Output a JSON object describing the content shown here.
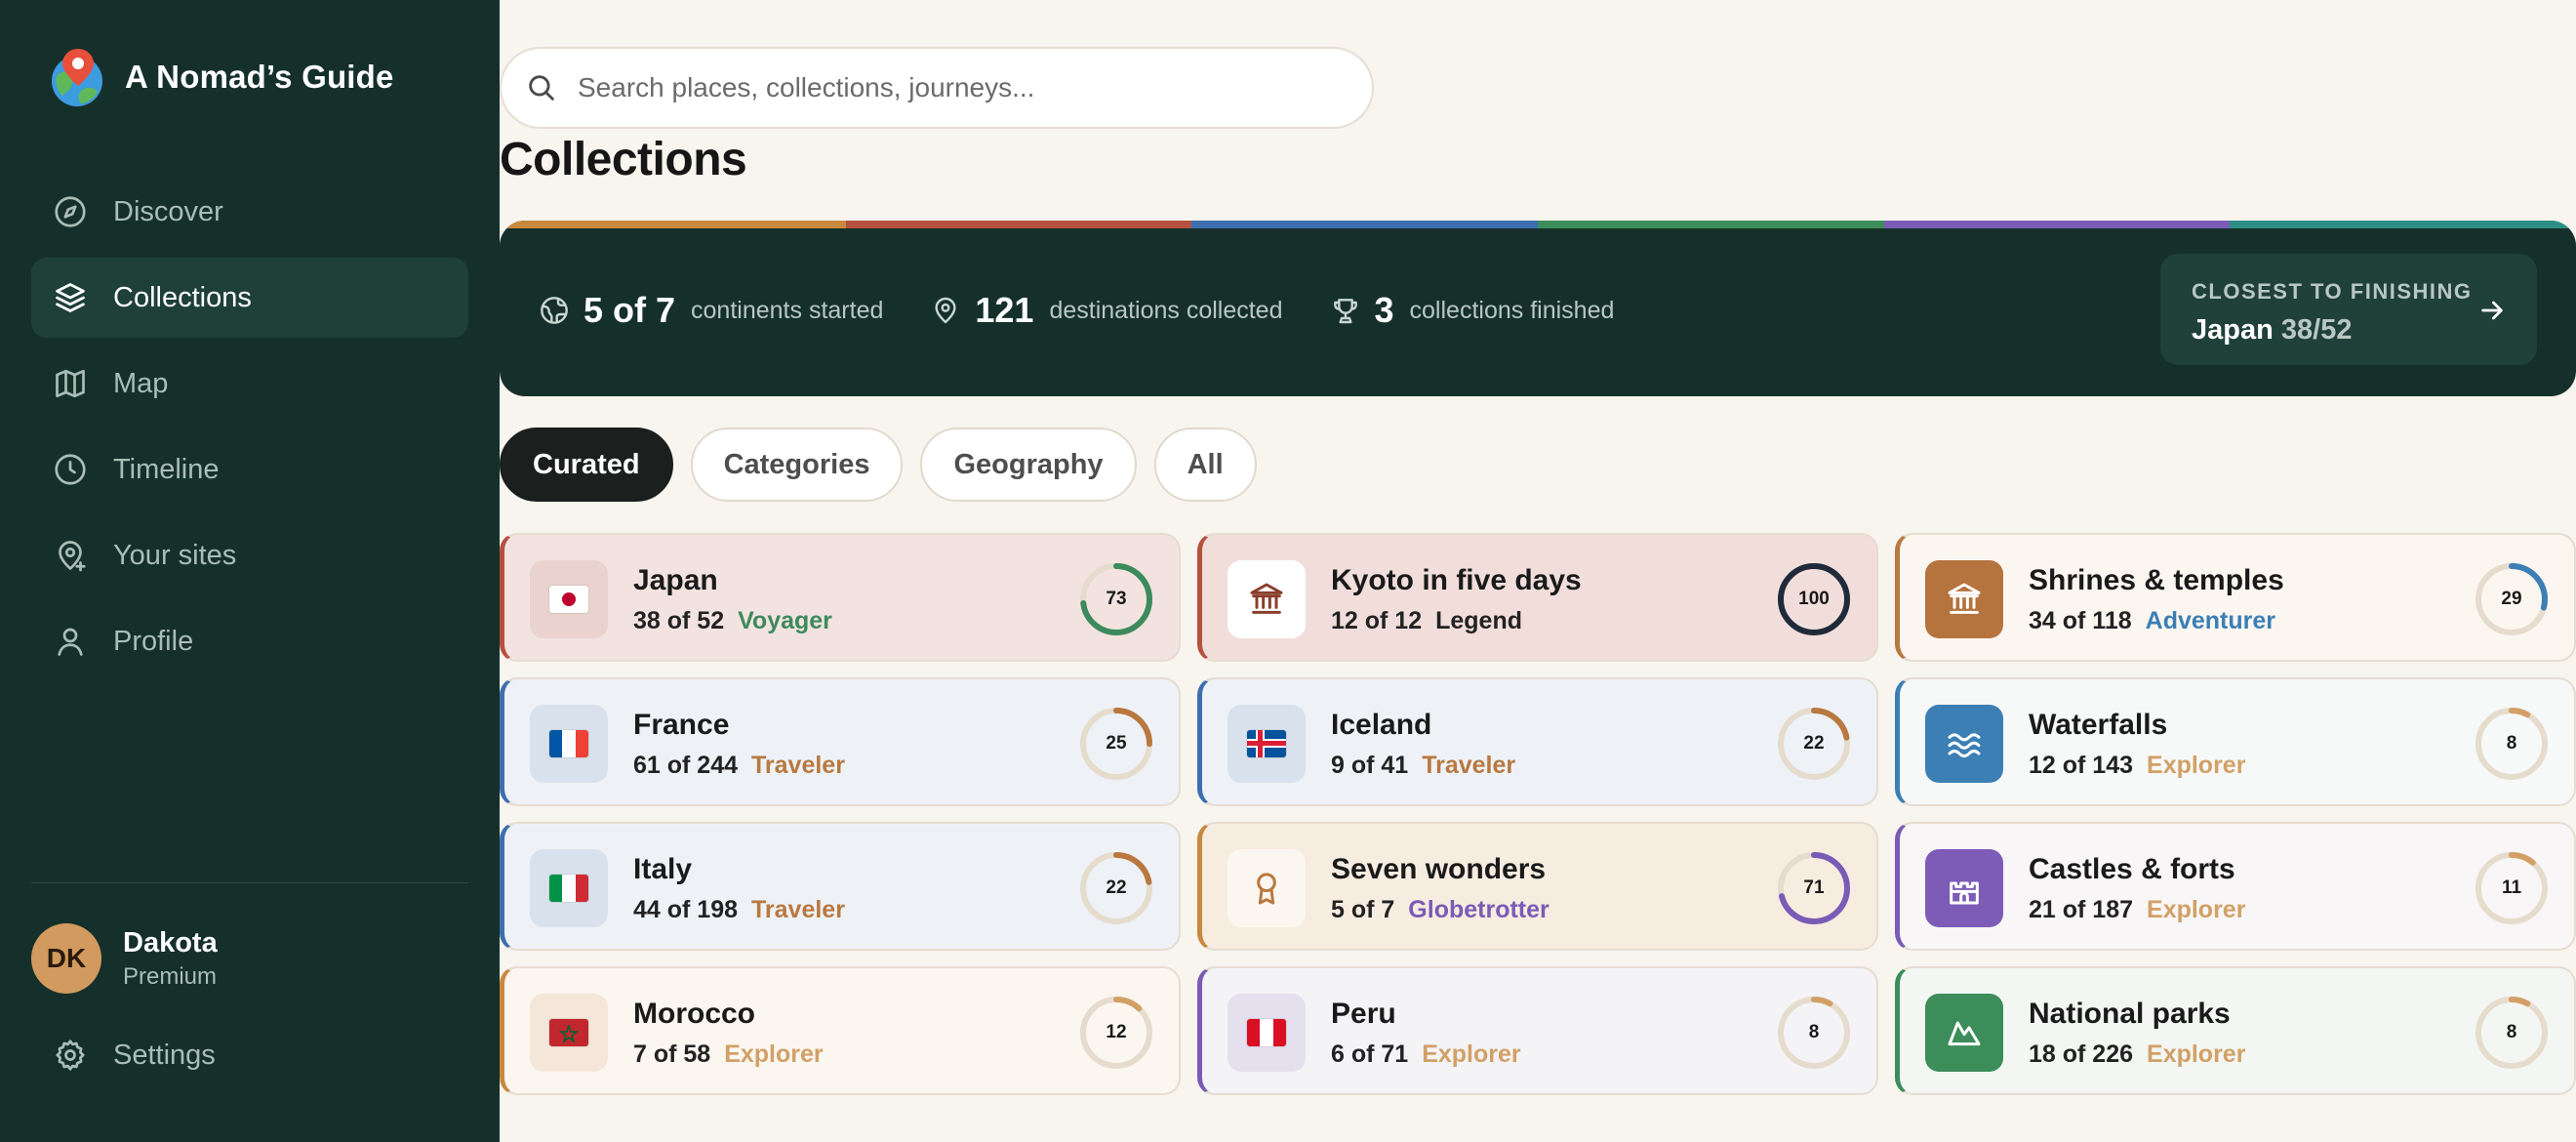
{
  "app": {
    "title": "A Nomad’s Guide"
  },
  "sidebar": {
    "items": [
      {
        "label": "Discover",
        "icon": "compass-icon",
        "active": false
      },
      {
        "label": "Collections",
        "icon": "layers-icon",
        "active": true
      },
      {
        "label": "Map",
        "icon": "map-icon",
        "active": false
      },
      {
        "label": "Timeline",
        "icon": "clock-icon",
        "active": false
      },
      {
        "label": "Your sites",
        "icon": "pin-plus-icon",
        "active": false
      },
      {
        "label": "Profile",
        "icon": "user-icon",
        "active": false
      }
    ],
    "user": {
      "initials": "DK",
      "name": "Dakota",
      "plan": "Premium"
    },
    "settings_label": "Settings"
  },
  "search": {
    "placeholder": "Search places, collections, journeys..."
  },
  "page": {
    "title": "Collections"
  },
  "stats": {
    "continents": {
      "value": "5 of 7",
      "label": "continents started"
    },
    "destinations": {
      "value": "121",
      "label": "destinations collected"
    },
    "finished": {
      "value": "3",
      "label": "collections finished"
    },
    "closest": {
      "label": "CLOSEST TO FINISHING",
      "name": "Japan",
      "count": "38/52"
    },
    "stripe_colors": [
      "#c8883f",
      "#b5503f",
      "#3d6fb0",
      "#3c8d5a",
      "#7a5bb5",
      "#2e8f86"
    ]
  },
  "tabs": [
    {
      "label": "Curated",
      "active": true
    },
    {
      "label": "Categories",
      "active": false
    },
    {
      "label": "Geography",
      "active": false
    },
    {
      "label": "All",
      "active": false
    }
  ],
  "colors": {
    "voyager": "#3d8a5c",
    "legend": "#1f2a3a",
    "adventurer": "#3b7fb5",
    "traveler": "#b87840",
    "explorer": "#d2a066",
    "globetrotter": "#7a5bb5"
  },
  "cards": [
    {
      "title": "Japan",
      "count": "38 of 52",
      "level": "Voyager",
      "percent": "73",
      "icon": "japan-flag-icon",
      "accent": "#b5503f",
      "bg": "#f3e3e0",
      "iconbg": "#ead3cf",
      "levelColor": "#3d8a5c",
      "ringColor": "#3d8a5c"
    },
    {
      "title": "Kyoto in five days",
      "count": "12 of 12",
      "level": "Legend",
      "percent": "100",
      "icon": "temple-icon",
      "accent": "#b5503f",
      "bg": "#f1dedb",
      "iconbg": "#ffffff",
      "levelColor": "#222222",
      "ringColor": "#1f2a3a"
    },
    {
      "title": "Shrines & temples",
      "count": "34 of 118",
      "level": "Adventurer",
      "percent": "29",
      "icon": "temple-icon",
      "accent": "#b87840",
      "bg": "#fbf6f0",
      "iconbg": "#b5733e",
      "levelColor": "#3b7fb5",
      "ringColor": "#3b7fb5"
    },
    {
      "title": "France",
      "count": "61 of 244",
      "level": "Traveler",
      "percent": "25",
      "icon": "france-flag-icon",
      "accent": "#3d6fb0",
      "bg": "#eef2f7",
      "iconbg": "#d9e2ec",
      "levelColor": "#b87840",
      "ringColor": "#b87840"
    },
    {
      "title": "Iceland",
      "count": "9 of 41",
      "level": "Traveler",
      "percent": "22",
      "icon": "iceland-flag-icon",
      "accent": "#3d6fb0",
      "bg": "#eef2f7",
      "iconbg": "#d9e2ec",
      "levelColor": "#b87840",
      "ringColor": "#b87840"
    },
    {
      "title": "Waterfalls",
      "count": "12 of 143",
      "level": "Explorer",
      "percent": "8",
      "icon": "waves-icon",
      "accent": "#3b7fb5",
      "bg": "#f7f8f8",
      "iconbg": "#3b7fb5",
      "levelColor": "#d2a066",
      "ringColor": "#d2a066"
    },
    {
      "title": "Italy",
      "count": "44 of 198",
      "level": "Traveler",
      "percent": "22",
      "icon": "italy-flag-icon",
      "accent": "#3d6fb0",
      "bg": "#eef2f7",
      "iconbg": "#d9e2ec",
      "levelColor": "#b87840",
      "ringColor": "#b87840"
    },
    {
      "title": "Seven wonders",
      "count": "5 of 7",
      "level": "Globetrotter",
      "percent": "71",
      "icon": "award-icon",
      "accent": "#c8883f",
      "bg": "#f7ece0",
      "iconbg": "#fbf6f0",
      "levelColor": "#7a5bb5",
      "ringColor": "#7a5bb5"
    },
    {
      "title": "Castles & forts",
      "count": "21 of 187",
      "level": "Explorer",
      "percent": "11",
      "icon": "castle-icon",
      "accent": "#7a5bb5",
      "bg": "#f8f6f6",
      "iconbg": "#7d5cb8",
      "levelColor": "#d2a066",
      "ringColor": "#d2a066"
    },
    {
      "title": "Morocco",
      "count": "7 of 58",
      "level": "Explorer",
      "percent": "12",
      "icon": "morocco-flag-icon",
      "accent": "#c8883f",
      "bg": "#fbf6f0",
      "iconbg": "#f4e6d8",
      "levelColor": "#d2a066",
      "ringColor": "#d2a066"
    },
    {
      "title": "Peru",
      "count": "6 of 71",
      "level": "Explorer",
      "percent": "8",
      "icon": "peru-flag-icon",
      "accent": "#7a5bb5",
      "bg": "#f4f3f6",
      "iconbg": "#e5e0ee",
      "levelColor": "#d2a066",
      "ringColor": "#d2a066"
    },
    {
      "title": "National parks",
      "count": "18 of 226",
      "level": "Explorer",
      "percent": "8",
      "icon": "mountain-icon",
      "accent": "#3c8d5a",
      "bg": "#f3f6f3",
      "iconbg": "#3c8d5a",
      "levelColor": "#d2a066",
      "ringColor": "#d2a066"
    }
  ]
}
